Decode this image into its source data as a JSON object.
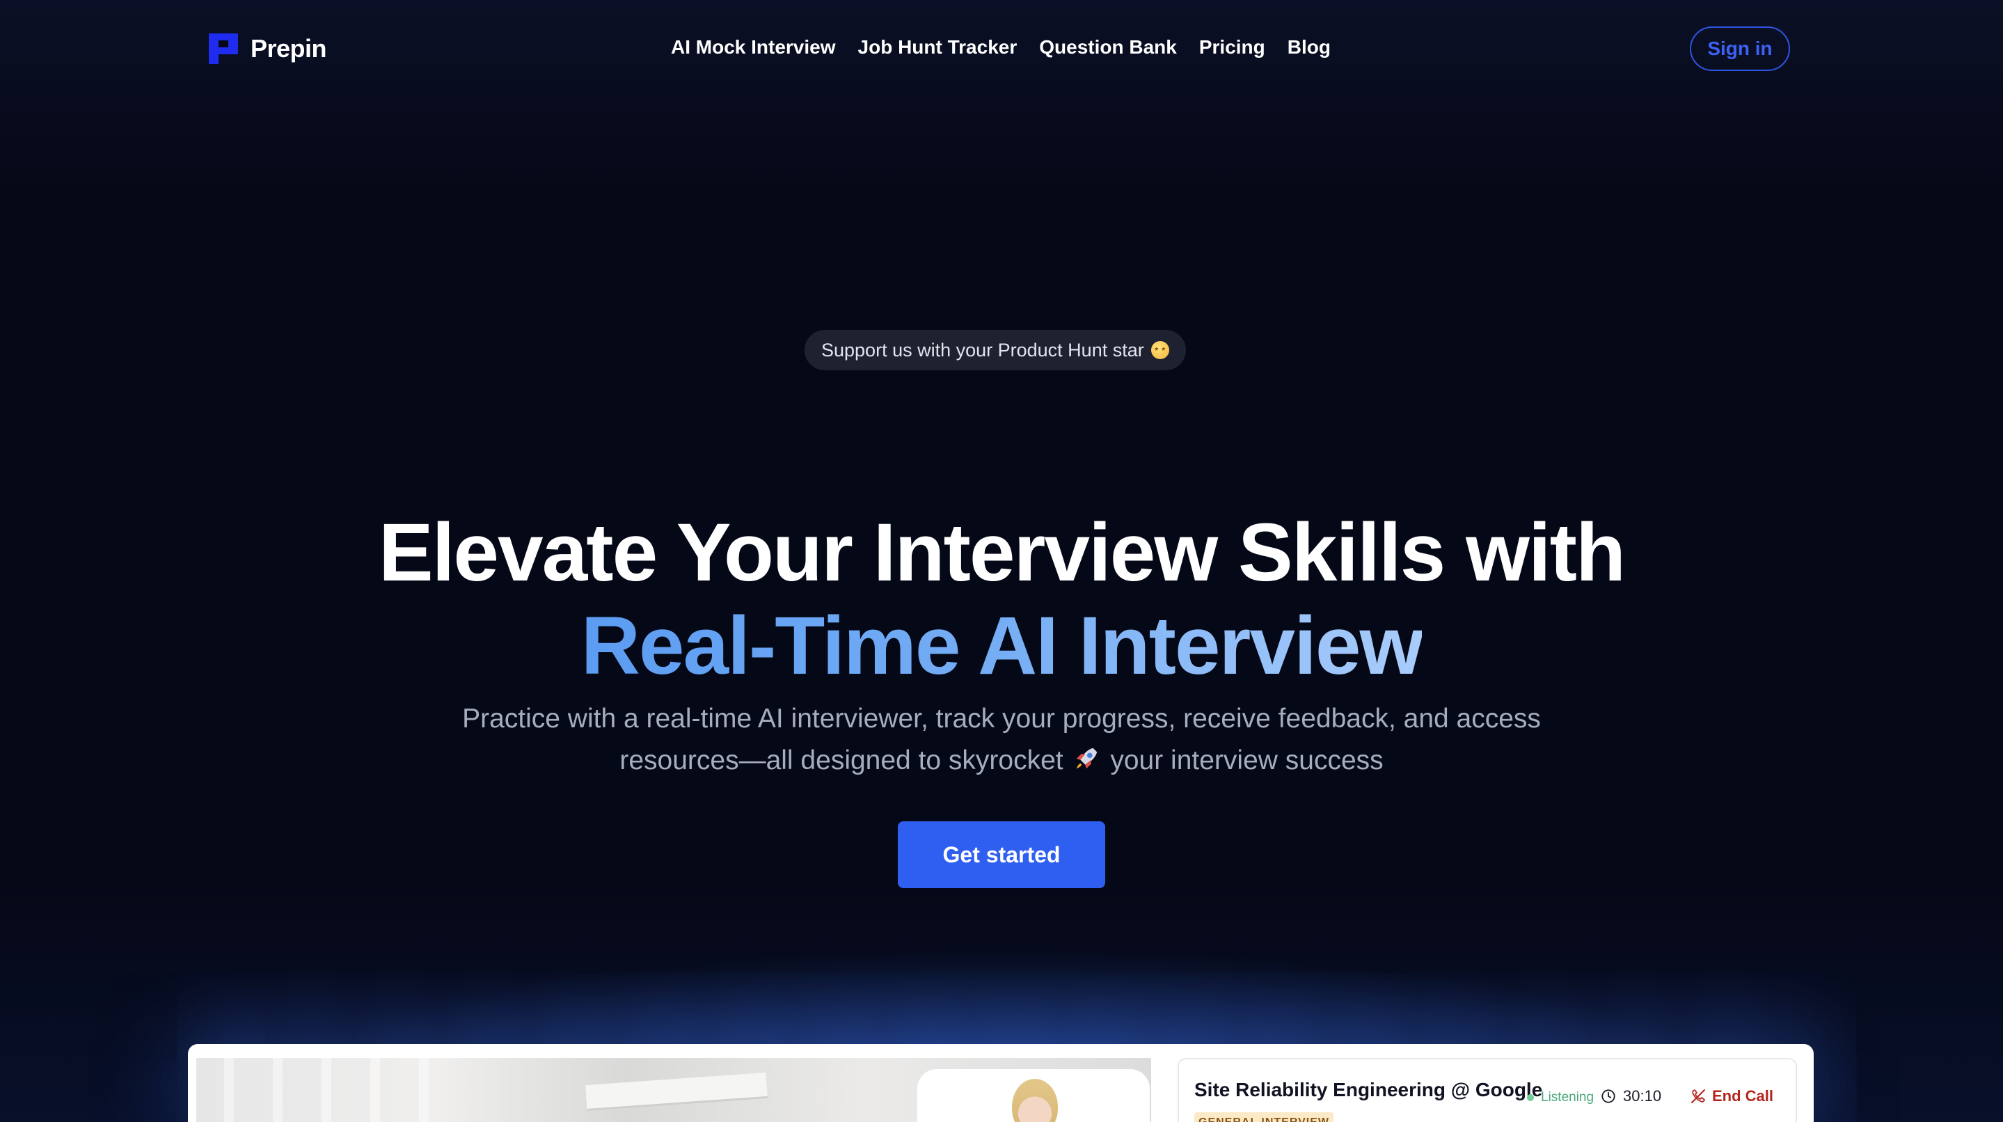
{
  "brand": {
    "name": "Prepin",
    "accent": "#1f2cf0"
  },
  "nav": {
    "links": [
      {
        "label": "AI Mock Interview"
      },
      {
        "label": "Job Hunt Tracker"
      },
      {
        "label": "Question Bank"
      },
      {
        "label": "Pricing"
      },
      {
        "label": "Blog"
      }
    ],
    "signin_label": "Sign in"
  },
  "hero": {
    "badge_text": "Support us with your Product Hunt star",
    "badge_icon": "star-struck-emoji-icon",
    "headline_line1": "Elevate Your Interview Skills with",
    "headline_line2": "Real-Time AI Interview",
    "subtitle_part1": "Practice with a real-time AI interviewer, track your progress, receive feedback, and access resources—all designed to skyrocket",
    "subtitle_icon": "rocket-icon",
    "subtitle_part2": "your interview success",
    "cta_label": "Get started",
    "cta_color": "#2f5ff0",
    "headline_gradient": [
      "#5b9cf2",
      "#a9ccfb"
    ]
  },
  "preview": {
    "job_title": "Site Reliability Engineering @ Google",
    "interview_type": "GENERAL INTERVIEW",
    "status_label": "Listening",
    "status_color": "#4ca77a",
    "timer": "30:10",
    "timer_icon": "clock-icon",
    "end_call_label": "End Call",
    "end_call_icon": "phone-off-icon",
    "end_call_color": "#b3261e"
  }
}
